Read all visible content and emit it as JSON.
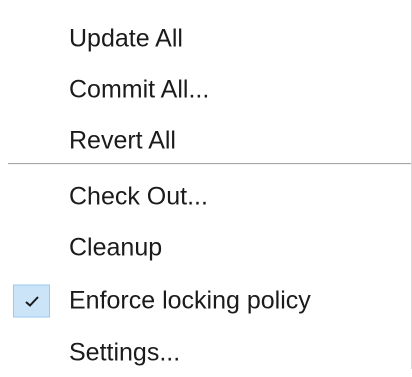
{
  "menu": {
    "group1": [
      {
        "label": "Update All"
      },
      {
        "label": "Commit All..."
      },
      {
        "label": "Revert All"
      }
    ],
    "group2": [
      {
        "label": "Check Out..."
      },
      {
        "label": "Cleanup"
      },
      {
        "label": "Enforce locking policy",
        "checked": true
      },
      {
        "label": "Settings..."
      }
    ]
  },
  "colors": {
    "check_background": "#cce4f7",
    "check_border": "#99c9ef",
    "text": "#1b1b1b"
  },
  "icons": {
    "checked_item": "checkmark-icon"
  }
}
